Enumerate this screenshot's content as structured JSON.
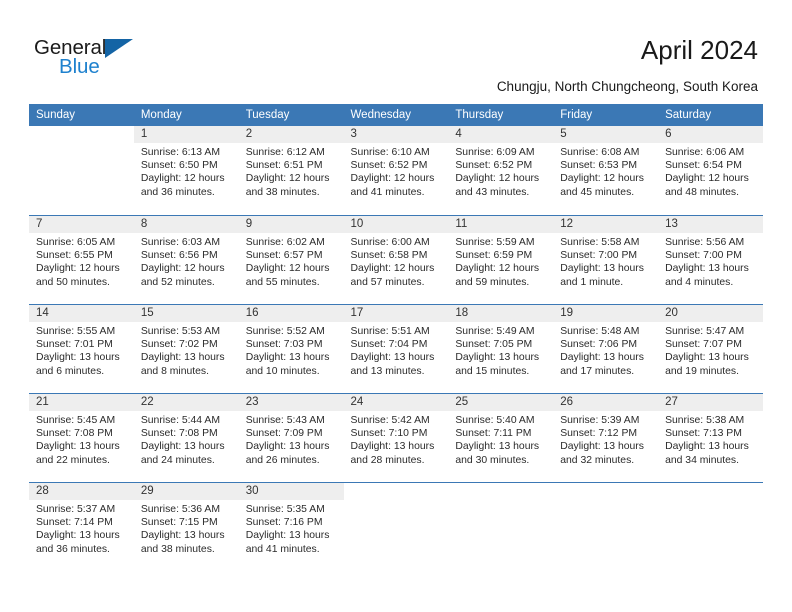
{
  "brand": {
    "name_top": "General",
    "name_bottom": "Blue",
    "accent_color": "#1e81ce",
    "triangle_color": "#1464a5",
    "logo_icon": "triangle-icon"
  },
  "header": {
    "title": "April 2024",
    "subtitle": "Chungju, North Chungcheong, South Korea",
    "header_bg": "#3b78b5",
    "daynum_bg": "#eeeeee"
  },
  "calendar": {
    "weekday_headers": [
      "Sunday",
      "Monday",
      "Tuesday",
      "Wednesday",
      "Thursday",
      "Friday",
      "Saturday"
    ],
    "labels": {
      "sunrise": "Sunrise:",
      "sunset": "Sunset:",
      "daylight": "Daylight:"
    },
    "weeks": [
      [
        {
          "day": "",
          "blank": true
        },
        {
          "day": "1",
          "sunrise": "Sunrise: 6:13 AM",
          "sunset": "Sunset: 6:50 PM",
          "daylight_l1": "Daylight: 12 hours",
          "daylight_l2": "and 36 minutes."
        },
        {
          "day": "2",
          "sunrise": "Sunrise: 6:12 AM",
          "sunset": "Sunset: 6:51 PM",
          "daylight_l1": "Daylight: 12 hours",
          "daylight_l2": "and 38 minutes."
        },
        {
          "day": "3",
          "sunrise": "Sunrise: 6:10 AM",
          "sunset": "Sunset: 6:52 PM",
          "daylight_l1": "Daylight: 12 hours",
          "daylight_l2": "and 41 minutes."
        },
        {
          "day": "4",
          "sunrise": "Sunrise: 6:09 AM",
          "sunset": "Sunset: 6:52 PM",
          "daylight_l1": "Daylight: 12 hours",
          "daylight_l2": "and 43 minutes."
        },
        {
          "day": "5",
          "sunrise": "Sunrise: 6:08 AM",
          "sunset": "Sunset: 6:53 PM",
          "daylight_l1": "Daylight: 12 hours",
          "daylight_l2": "and 45 minutes."
        },
        {
          "day": "6",
          "sunrise": "Sunrise: 6:06 AM",
          "sunset": "Sunset: 6:54 PM",
          "daylight_l1": "Daylight: 12 hours",
          "daylight_l2": "and 48 minutes."
        }
      ],
      [
        {
          "day": "7",
          "sunrise": "Sunrise: 6:05 AM",
          "sunset": "Sunset: 6:55 PM",
          "daylight_l1": "Daylight: 12 hours",
          "daylight_l2": "and 50 minutes."
        },
        {
          "day": "8",
          "sunrise": "Sunrise: 6:03 AM",
          "sunset": "Sunset: 6:56 PM",
          "daylight_l1": "Daylight: 12 hours",
          "daylight_l2": "and 52 minutes."
        },
        {
          "day": "9",
          "sunrise": "Sunrise: 6:02 AM",
          "sunset": "Sunset: 6:57 PM",
          "daylight_l1": "Daylight: 12 hours",
          "daylight_l2": "and 55 minutes."
        },
        {
          "day": "10",
          "sunrise": "Sunrise: 6:00 AM",
          "sunset": "Sunset: 6:58 PM",
          "daylight_l1": "Daylight: 12 hours",
          "daylight_l2": "and 57 minutes."
        },
        {
          "day": "11",
          "sunrise": "Sunrise: 5:59 AM",
          "sunset": "Sunset: 6:59 PM",
          "daylight_l1": "Daylight: 12 hours",
          "daylight_l2": "and 59 minutes."
        },
        {
          "day": "12",
          "sunrise": "Sunrise: 5:58 AM",
          "sunset": "Sunset: 7:00 PM",
          "daylight_l1": "Daylight: 13 hours",
          "daylight_l2": "and 1 minute."
        },
        {
          "day": "13",
          "sunrise": "Sunrise: 5:56 AM",
          "sunset": "Sunset: 7:00 PM",
          "daylight_l1": "Daylight: 13 hours",
          "daylight_l2": "and 4 minutes."
        }
      ],
      [
        {
          "day": "14",
          "sunrise": "Sunrise: 5:55 AM",
          "sunset": "Sunset: 7:01 PM",
          "daylight_l1": "Daylight: 13 hours",
          "daylight_l2": "and 6 minutes."
        },
        {
          "day": "15",
          "sunrise": "Sunrise: 5:53 AM",
          "sunset": "Sunset: 7:02 PM",
          "daylight_l1": "Daylight: 13 hours",
          "daylight_l2": "and 8 minutes."
        },
        {
          "day": "16",
          "sunrise": "Sunrise: 5:52 AM",
          "sunset": "Sunset: 7:03 PM",
          "daylight_l1": "Daylight: 13 hours",
          "daylight_l2": "and 10 minutes."
        },
        {
          "day": "17",
          "sunrise": "Sunrise: 5:51 AM",
          "sunset": "Sunset: 7:04 PM",
          "daylight_l1": "Daylight: 13 hours",
          "daylight_l2": "and 13 minutes."
        },
        {
          "day": "18",
          "sunrise": "Sunrise: 5:49 AM",
          "sunset": "Sunset: 7:05 PM",
          "daylight_l1": "Daylight: 13 hours",
          "daylight_l2": "and 15 minutes."
        },
        {
          "day": "19",
          "sunrise": "Sunrise: 5:48 AM",
          "sunset": "Sunset: 7:06 PM",
          "daylight_l1": "Daylight: 13 hours",
          "daylight_l2": "and 17 minutes."
        },
        {
          "day": "20",
          "sunrise": "Sunrise: 5:47 AM",
          "sunset": "Sunset: 7:07 PM",
          "daylight_l1": "Daylight: 13 hours",
          "daylight_l2": "and 19 minutes."
        }
      ],
      [
        {
          "day": "21",
          "sunrise": "Sunrise: 5:45 AM",
          "sunset": "Sunset: 7:08 PM",
          "daylight_l1": "Daylight: 13 hours",
          "daylight_l2": "and 22 minutes."
        },
        {
          "day": "22",
          "sunrise": "Sunrise: 5:44 AM",
          "sunset": "Sunset: 7:08 PM",
          "daylight_l1": "Daylight: 13 hours",
          "daylight_l2": "and 24 minutes."
        },
        {
          "day": "23",
          "sunrise": "Sunrise: 5:43 AM",
          "sunset": "Sunset: 7:09 PM",
          "daylight_l1": "Daylight: 13 hours",
          "daylight_l2": "and 26 minutes."
        },
        {
          "day": "24",
          "sunrise": "Sunrise: 5:42 AM",
          "sunset": "Sunset: 7:10 PM",
          "daylight_l1": "Daylight: 13 hours",
          "daylight_l2": "and 28 minutes."
        },
        {
          "day": "25",
          "sunrise": "Sunrise: 5:40 AM",
          "sunset": "Sunset: 7:11 PM",
          "daylight_l1": "Daylight: 13 hours",
          "daylight_l2": "and 30 minutes."
        },
        {
          "day": "26",
          "sunrise": "Sunrise: 5:39 AM",
          "sunset": "Sunset: 7:12 PM",
          "daylight_l1": "Daylight: 13 hours",
          "daylight_l2": "and 32 minutes."
        },
        {
          "day": "27",
          "sunrise": "Sunrise: 5:38 AM",
          "sunset": "Sunset: 7:13 PM",
          "daylight_l1": "Daylight: 13 hours",
          "daylight_l2": "and 34 minutes."
        }
      ],
      [
        {
          "day": "28",
          "sunrise": "Sunrise: 5:37 AM",
          "sunset": "Sunset: 7:14 PM",
          "daylight_l1": "Daylight: 13 hours",
          "daylight_l2": "and 36 minutes."
        },
        {
          "day": "29",
          "sunrise": "Sunrise: 5:36 AM",
          "sunset": "Sunset: 7:15 PM",
          "daylight_l1": "Daylight: 13 hours",
          "daylight_l2": "and 38 minutes."
        },
        {
          "day": "30",
          "sunrise": "Sunrise: 5:35 AM",
          "sunset": "Sunset: 7:16 PM",
          "daylight_l1": "Daylight: 13 hours",
          "daylight_l2": "and 41 minutes."
        },
        {
          "day": "",
          "blank": true
        },
        {
          "day": "",
          "blank": true
        },
        {
          "day": "",
          "blank": true
        },
        {
          "day": "",
          "blank": true
        }
      ]
    ]
  }
}
